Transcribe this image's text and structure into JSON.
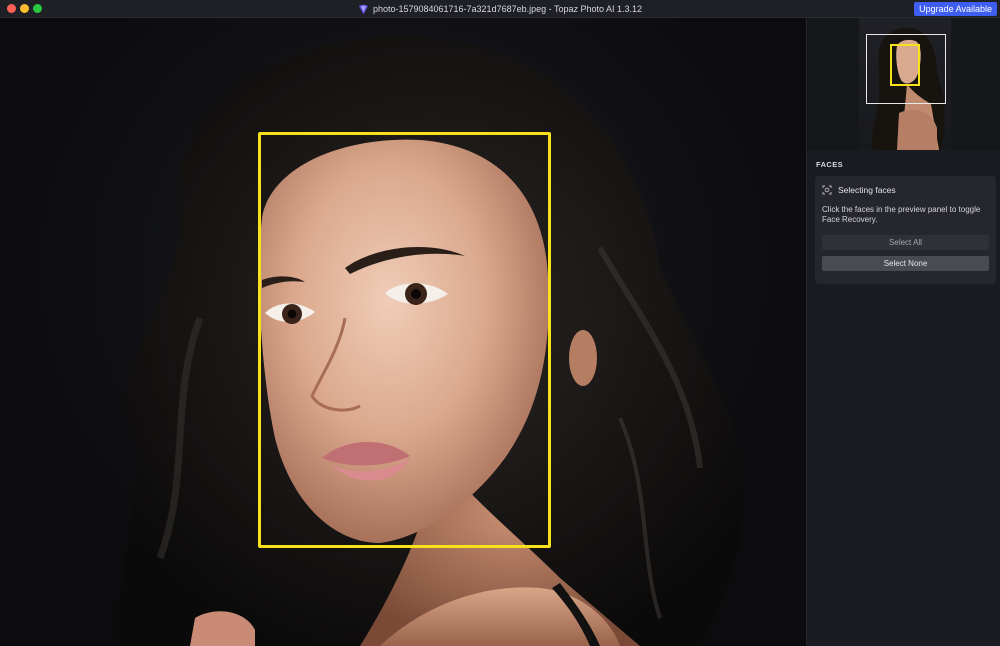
{
  "titlebar": {
    "title": "photo-1579084061716-7a321d7687eb.jpeg - Topaz Photo AI 1.3.12",
    "upgrade_label": "Upgrade Available",
    "accent_color": "#3e5ef0"
  },
  "preview": {
    "face_box_color": "#f7e11a"
  },
  "sidebar": {
    "section_label": "FACES",
    "card": {
      "icon": "face-scan-icon",
      "title": "Selecting faces",
      "description": "Click the faces in the preview panel to toggle Face Recovery.",
      "select_all_label": "Select All",
      "select_none_label": "Select None"
    }
  }
}
